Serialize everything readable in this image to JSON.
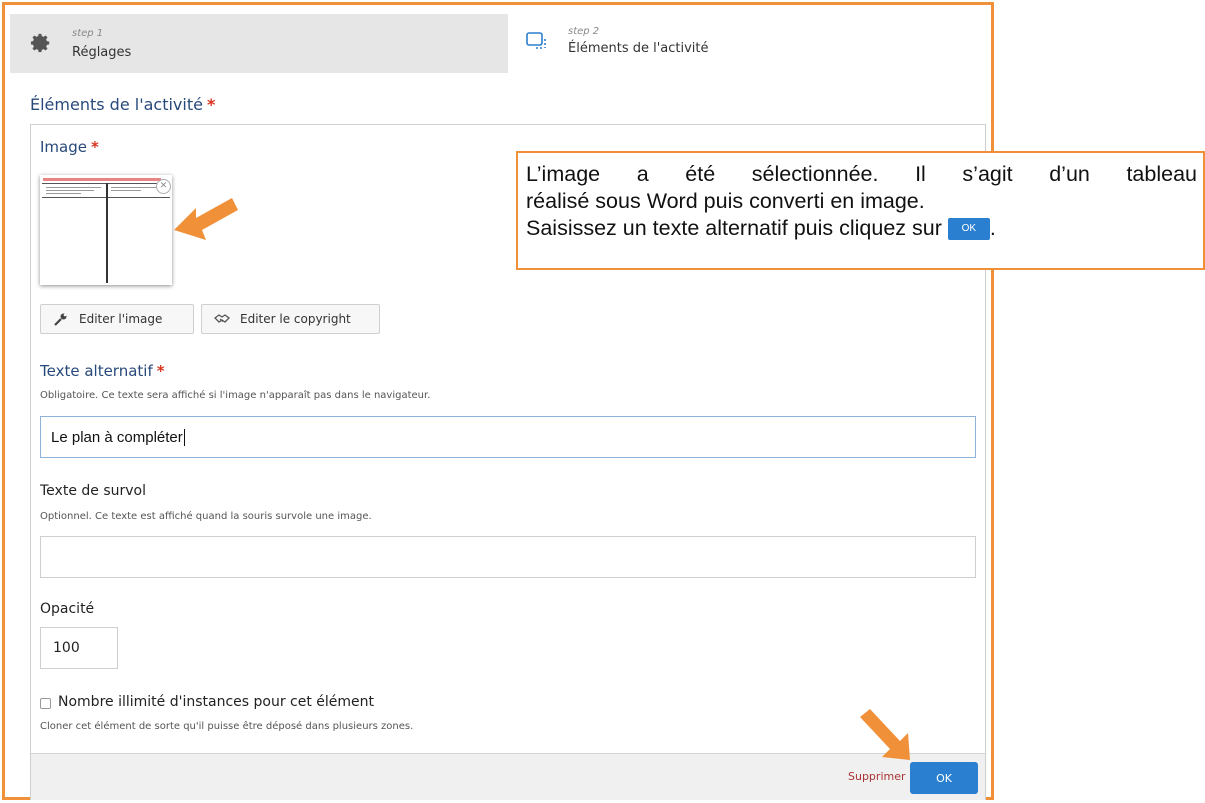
{
  "steps": [
    {
      "small": "step 1",
      "label": "Réglages",
      "icon": "gear-icon"
    },
    {
      "small": "step 2",
      "label": "Éléments de l'activité",
      "icon": "elements-icon"
    }
  ],
  "section": {
    "title": "Éléments de l'activité",
    "required_mark": "*"
  },
  "image_field": {
    "label": "Image",
    "required_mark": "*",
    "edit_image_label": "Editer l'image",
    "edit_copyright_label": "Editer le copyright"
  },
  "alt_text": {
    "label": "Texte alternatif",
    "required_mark": "*",
    "description": "Obligatoire. Ce texte sera affiché si l'image n'apparaît pas dans le navigateur.",
    "value": "Le plan à compléter"
  },
  "hover_text": {
    "label": "Texte de survol",
    "description": "Optionnel. Ce texte est affiché quand la souris survole une image.",
    "value": ""
  },
  "opacity": {
    "label": "Opacité",
    "value": "100"
  },
  "unlimited": {
    "label": "Nombre illimité d'instances pour cet élément",
    "description": "Cloner cet élément de sorte qu'il puisse être déposé dans plusieurs zones.",
    "checked": false
  },
  "footer": {
    "delete_label": "Supprimer",
    "ok_label": "OK"
  },
  "callout": {
    "line1": "L’image a été sélectionnée. Il s’agit d’un tableau",
    "line2": "réalisé sous Word puis converti en image.",
    "line3": "Saisissez un texte alternatif puis cliquez sur",
    "ok_label": "OK",
    "period": "."
  },
  "colors": {
    "accent_orange": "#f0913a",
    "primary_blue": "#2b7fd0",
    "required_red": "#d9331f",
    "title_blue": "#284a7a"
  }
}
